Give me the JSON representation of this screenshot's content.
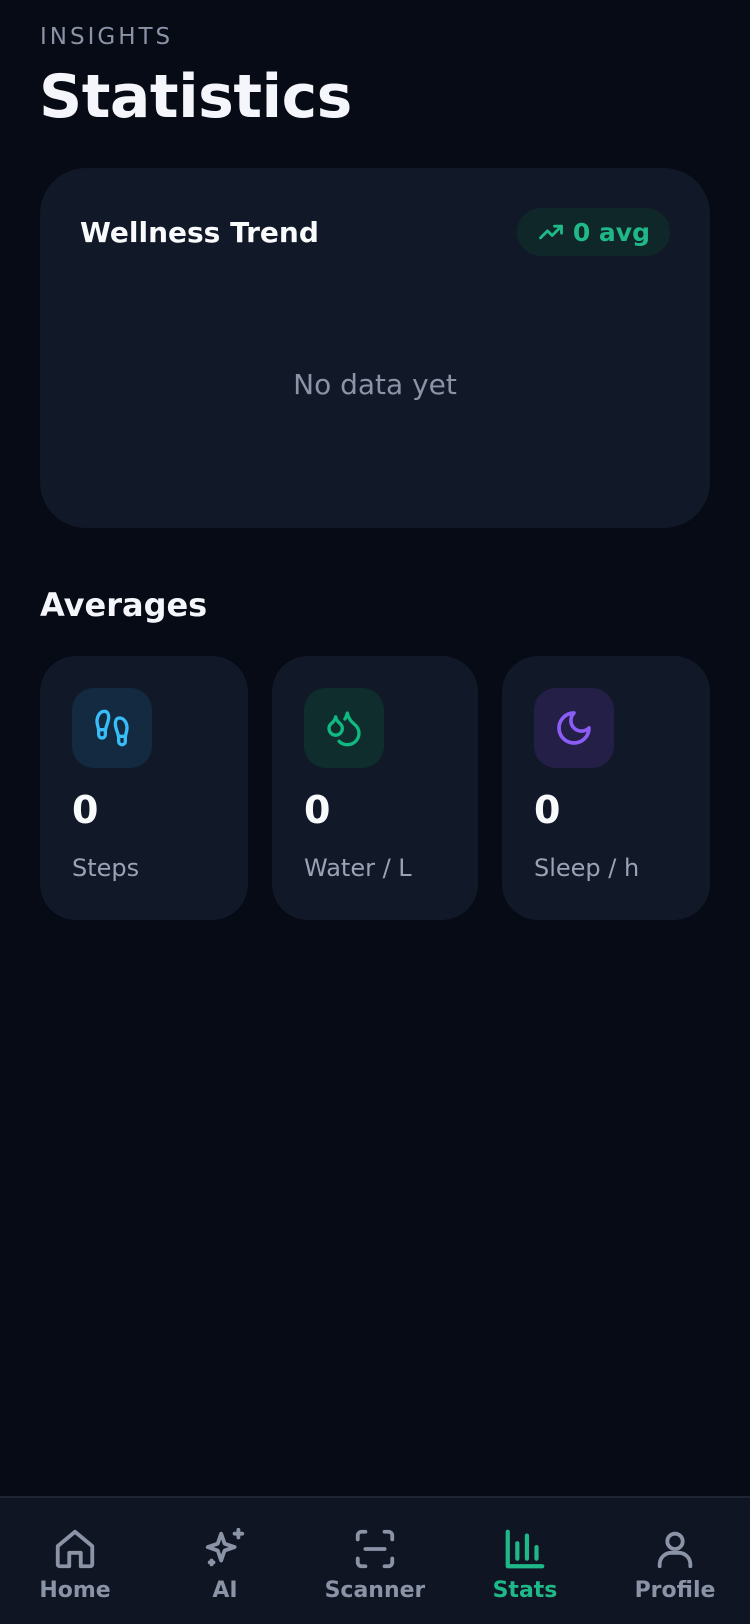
{
  "header": {
    "eyebrow": "INSIGHTS",
    "title": "Statistics"
  },
  "trend_card": {
    "title": "Wellness Trend",
    "avg_badge": "0 avg",
    "empty_message": "No data yet"
  },
  "averages": {
    "section_title": "Averages",
    "cards": [
      {
        "value": "0",
        "label": "Steps",
        "icon": "footprints-icon",
        "accent": "#38bdf8"
      },
      {
        "value": "0",
        "label": "Water / L",
        "icon": "droplets-icon",
        "accent": "#10b981"
      },
      {
        "value": "0",
        "label": "Sleep / h",
        "icon": "moon-icon",
        "accent": "#8b5cf6"
      }
    ]
  },
  "bottom_nav": {
    "items": [
      {
        "label": "Home",
        "icon": "home-icon",
        "active": false
      },
      {
        "label": "AI",
        "icon": "sparkles-icon",
        "active": false
      },
      {
        "label": "Scanner",
        "icon": "scan-icon",
        "active": false
      },
      {
        "label": "Stats",
        "icon": "bar-chart-icon",
        "active": true
      },
      {
        "label": "Profile",
        "icon": "user-icon",
        "active": false
      }
    ]
  },
  "colors": {
    "background": "#070b15",
    "card": "#111827",
    "accent_green": "#1fb888",
    "muted_text": "#8b93a7"
  }
}
